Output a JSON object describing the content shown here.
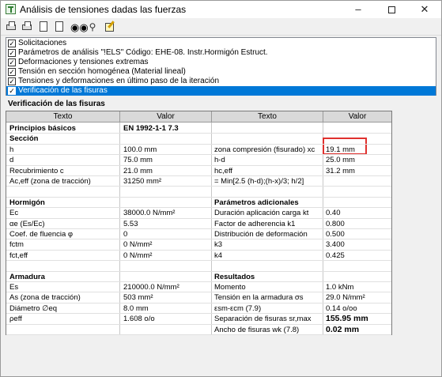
{
  "window": {
    "title": "Análisis de tensiones dadas las fuerzas"
  },
  "toolbar": {
    "icons": [
      "print-icon",
      "print-preview-icon",
      "copy-icon",
      "page-icon",
      "binoculars-icon",
      "search-settings-icon",
      "edit-icon"
    ]
  },
  "checklist": [
    {
      "label": "Solicitaciones",
      "checked": "✓"
    },
    {
      "label": "Parámetros de análisis \"!ELS\"   Código: EHE-08. Instr.Hormigón Estruct.",
      "checked": "✓"
    },
    {
      "label": "Deformaciones y tensiones extremas",
      "checked": "✓"
    },
    {
      "label": "Tensión en sección homogénea (Material lineal)",
      "checked": "✓"
    },
    {
      "label": "Tensiones y deformaciones en último paso de la iteración",
      "checked": "✓"
    },
    {
      "label": "Verificación de las fisuras",
      "checked": "✓"
    }
  ],
  "section_title": "Verificación de las fisuras",
  "table": {
    "headers": [
      "Texto",
      "Valor",
      "Texto",
      "Valor"
    ],
    "rows": [
      [
        "Principios básicos",
        "EN 1992-1-1   7.3",
        "",
        ""
      ],
      [
        "Sección",
        "",
        "",
        ""
      ],
      [
        "h",
        "100.0 mm",
        "zona compresión (fisurado)  xc",
        "19.1 mm"
      ],
      [
        "d",
        "75.0 mm",
        "h-d",
        "25.0 mm"
      ],
      [
        "Recubrimiento  c",
        "21.0 mm",
        "hc,eff",
        "31.2 mm"
      ],
      [
        "Ac,eff   (zona de tracción)",
        "31250 mm²",
        "= Min[2.5 (h-d);(h-x)/3; h/2]",
        ""
      ],
      [
        "",
        "",
        "",
        ""
      ],
      [
        "Hormigón",
        "",
        "Parámetros adicionales",
        ""
      ],
      [
        "Ec",
        "38000.0 N/mm²",
        "Duración aplicación carga kt",
        "0.40"
      ],
      [
        "αe  (Es/Ec)",
        "5.53",
        "Factor de adherencia  k1",
        "0.800"
      ],
      [
        "Coef. de fluencia φ",
        "0",
        "Distribución de deformación",
        "0.500"
      ],
      [
        "fctm",
        "0 N/mm²",
        "k3",
        "3.400"
      ],
      [
        "fct,eff",
        "0 N/mm²",
        "k4",
        "0.425"
      ],
      [
        "",
        "",
        "",
        ""
      ],
      [
        "Armadura",
        "",
        "Resultados",
        ""
      ],
      [
        "Es",
        "210000.0 N/mm²",
        "Momento",
        "1.0 kNm"
      ],
      [
        "As     (zona de tracción)",
        "503 mm²",
        "Tensión en la armadura σs",
        "29.0 N/mm²"
      ],
      [
        "Diámetro ∅eq",
        "8.0 mm",
        "εsm-εcm       (7.9)",
        "0.14 o/oo"
      ],
      [
        "ρeff",
        "1.608 o/o",
        "Separación de fisuras sr,max",
        "155.95 mm"
      ],
      [
        "",
        "",
        "Ancho de fisuras wk        (7.8)",
        "0.02 mm"
      ]
    ]
  }
}
